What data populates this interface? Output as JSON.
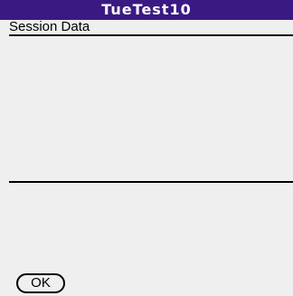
{
  "window": {
    "title": "TueTest10"
  },
  "main": {
    "section_label": "Session Data"
  },
  "buttons": {
    "ok_label": "OK"
  },
  "colors": {
    "title_bar": "#3a1a82",
    "background": "#efefef",
    "rule": "#000000"
  }
}
